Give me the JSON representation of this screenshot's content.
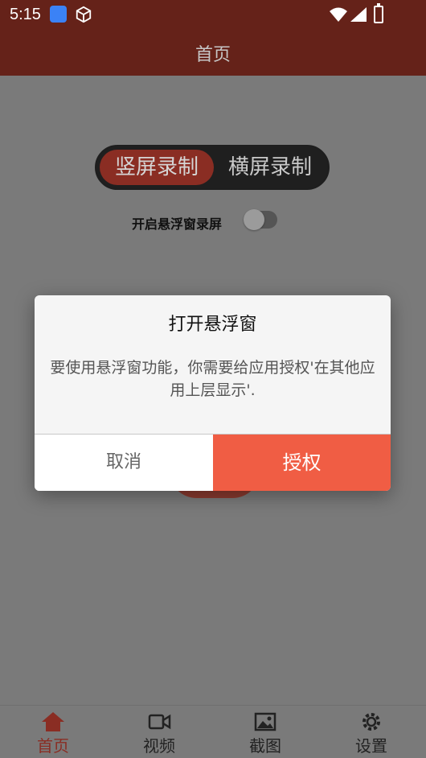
{
  "status_bar": {
    "time": "5:15",
    "icons": [
      "app-icon",
      "box-icon",
      "wifi-icon",
      "signal-icon",
      "battery-icon"
    ]
  },
  "header": {
    "title": "首页"
  },
  "segmented": {
    "left_label": "竖屏录制",
    "right_label": "横屏录制"
  },
  "float_window": {
    "label": "开启悬浮窗录屏",
    "enabled": false
  },
  "dialog": {
    "title": "打开悬浮窗",
    "message": "要使用悬浮窗功能，你需要给应用授权'在其他应用上层显示'.",
    "cancel_label": "取消",
    "confirm_label": "授权"
  },
  "bottom_nav": {
    "items": [
      {
        "label": "首页",
        "icon": "home-icon",
        "active": true
      },
      {
        "label": "视频",
        "icon": "video-icon",
        "active": false
      },
      {
        "label": "截图",
        "icon": "image-icon",
        "active": false
      },
      {
        "label": "设置",
        "icon": "gear-icon",
        "active": false
      }
    ]
  },
  "colors": {
    "primary_dark": "#652219",
    "accent": "#f05d44",
    "overlay": "#7a7a7a"
  }
}
